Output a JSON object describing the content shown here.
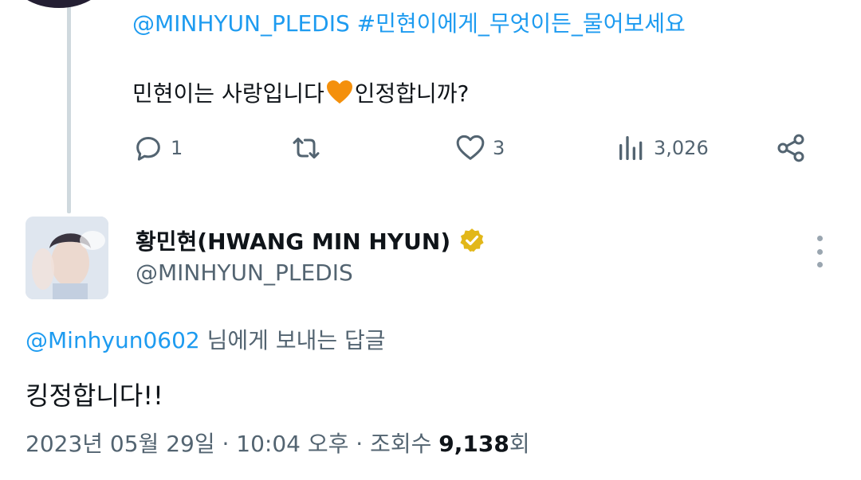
{
  "previous_tweet": {
    "mentions_line": "@MINHYUN_PLEDIS #민현이에게_무엇이든_물어보세요",
    "text_before": "민현이는 사랑입니다",
    "text_after": " 인정합니까?",
    "emoji": "orange-heart-icon",
    "actions": {
      "reply_count": "1",
      "like_count": "3",
      "views_count": "3,026"
    }
  },
  "reply_tweet": {
    "display_name": "황민현(HWANG MIN HYUN)",
    "handle": "@MINHYUN_PLEDIS",
    "replying_to_handle": "@Minhyun0602",
    "replying_to_suffix": " 님에게 보내는 답글",
    "text": "킹정합니다!!",
    "meta_date_time": "2023년 05월 29일 · 10:04 오후 · 조회수 ",
    "meta_views": "9,138",
    "meta_views_suffix": "회"
  },
  "colors": {
    "link": "#1d9bf0",
    "secondary_text": "#536471",
    "primary_text": "#0f1419",
    "thread_line": "#cfd9de",
    "verified_gold": "#e2b719"
  }
}
